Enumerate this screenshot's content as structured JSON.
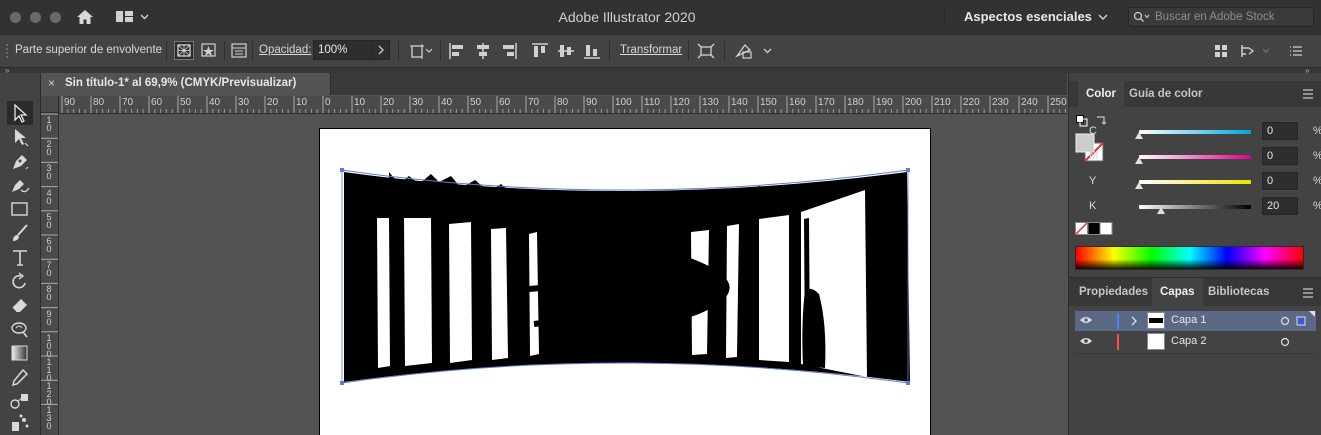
{
  "app": {
    "title": "Adobe Illustrator 2020",
    "workspace": "Aspectos esenciales",
    "stock_search_placeholder": "Buscar en Adobe Stock"
  },
  "control_bar": {
    "selection_label": "Parte superior de envolvente",
    "opacity_label": "Opacidad:",
    "opacity_value": "100%",
    "transform_label": "Transformar"
  },
  "document": {
    "tab_title": "Sin título-1* al 69,9% (CMYK/Previsualizar)",
    "close_glyph": "×"
  },
  "rulers": {
    "horizontal": [
      "90",
      "80",
      "70",
      "60",
      "50",
      "40",
      "30",
      "20",
      "10",
      "0",
      "10",
      "20",
      "30",
      "40",
      "50",
      "60",
      "70",
      "80",
      "90",
      "100",
      "110",
      "120",
      "130",
      "140",
      "150",
      "160",
      "170",
      "180",
      "190",
      "200",
      "210",
      "220",
      "230",
      "240",
      "250"
    ],
    "vertical": [
      "10",
      "20",
      "30",
      "40",
      "50",
      "60",
      "70",
      "80",
      "90",
      "100",
      "110",
      "120",
      "130"
    ]
  },
  "color_panel": {
    "tabs": [
      "Color",
      "Guía de color"
    ],
    "active_tab": "Color",
    "sliders": [
      {
        "label": "C",
        "value": "0",
        "unit": "%",
        "color": "#00a6e0"
      },
      {
        "label": "M",
        "value": "0",
        "unit": "%",
        "color": "#e0008c"
      },
      {
        "label": "Y",
        "value": "0",
        "unit": "%",
        "color": "#f0e000"
      },
      {
        "label": "K",
        "value": "20",
        "unit": "%",
        "color": "#000000"
      }
    ]
  },
  "layers_panel": {
    "tabs": [
      "Propiedades",
      "Capas",
      "Bibliotecas"
    ],
    "active_tab": "Capas",
    "layers": [
      {
        "name": "Capa 1",
        "color": "#4d7fff",
        "selected": true
      },
      {
        "name": "Capa 2",
        "color": "#ff4d4d",
        "selected": false
      }
    ]
  },
  "tools": [
    "selection-tool",
    "direct-selection-tool",
    "pen-tool",
    "curvature-tool",
    "rectangle-tool",
    "paintbrush-tool",
    "type-tool",
    "rotate-tool",
    "eraser-tool",
    "warp-tool",
    "gradient-tool",
    "eyedropper-tool",
    "blend-tool",
    "symbol-sprayer-tool"
  ]
}
